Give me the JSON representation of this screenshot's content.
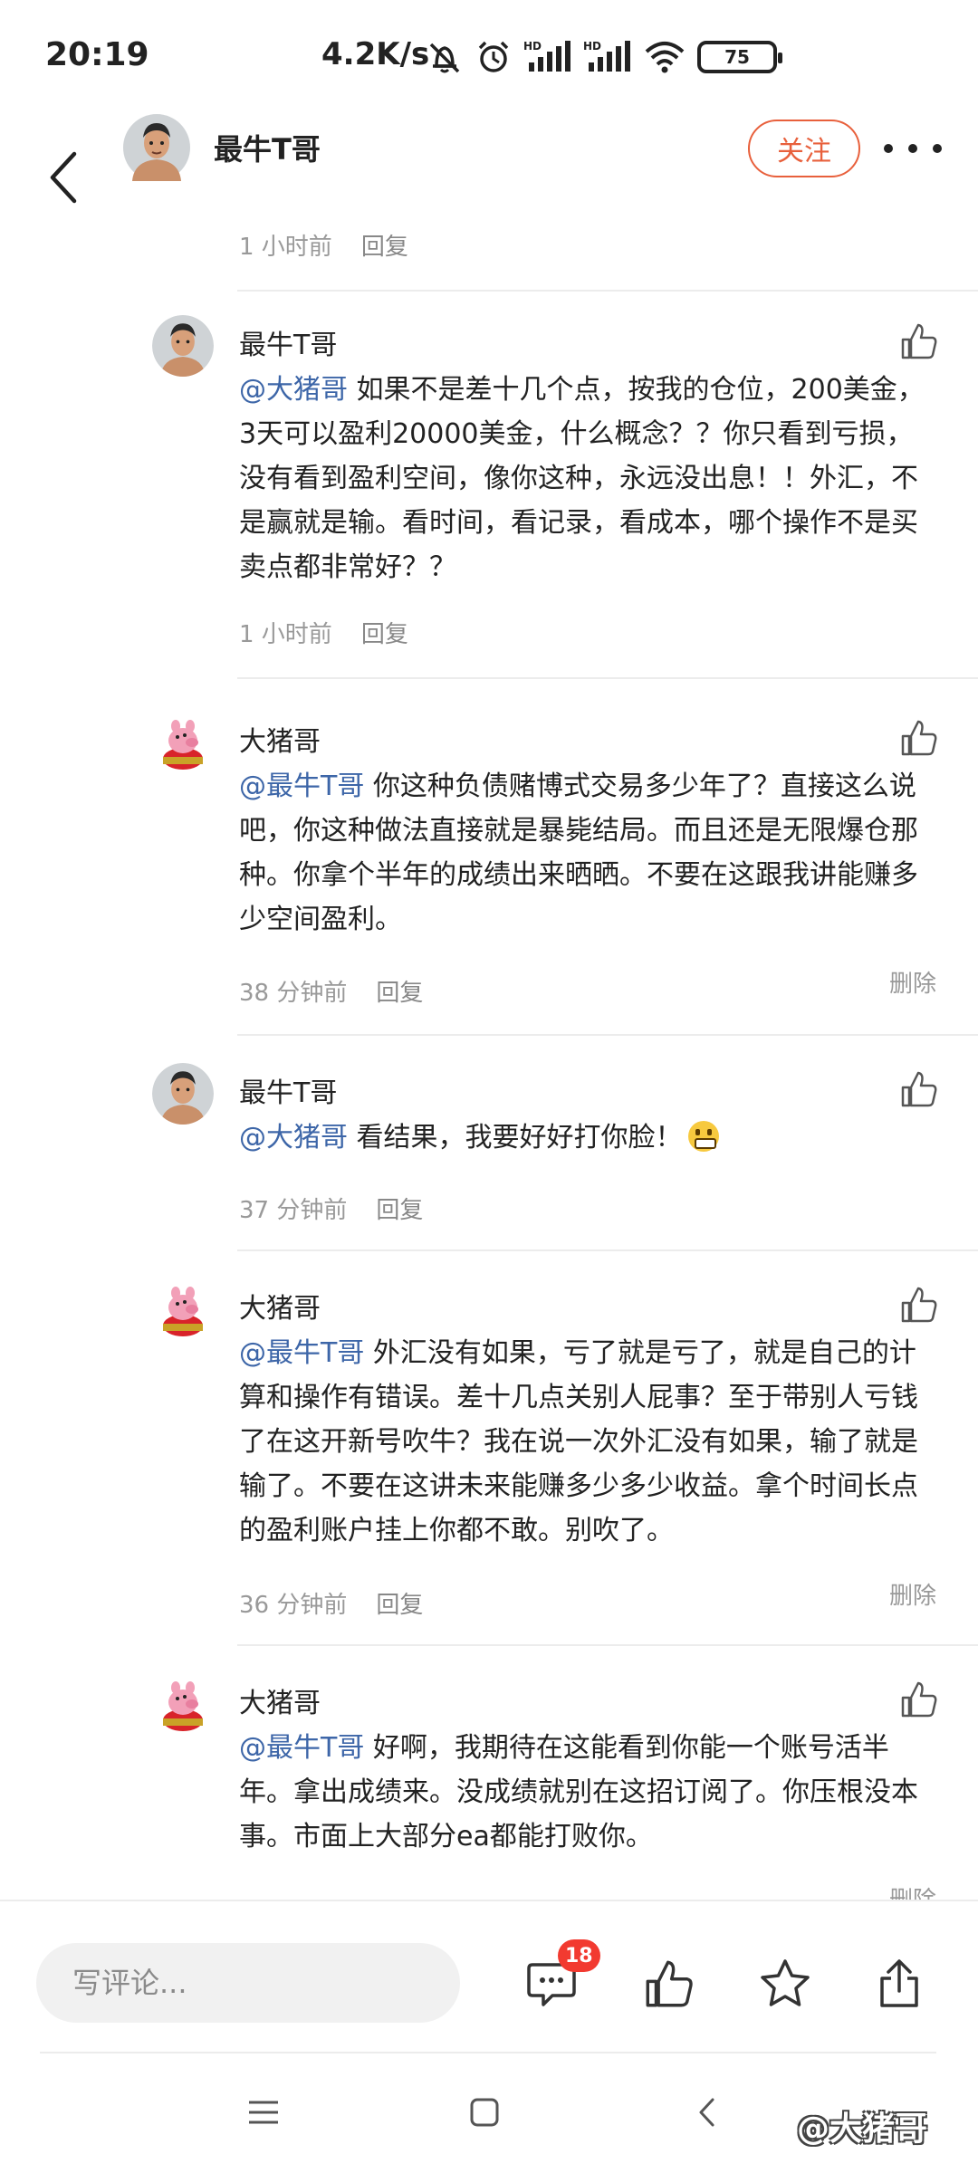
{
  "status_bar": {
    "time": "20:19",
    "network_speed": "4.2K/s",
    "battery": "75"
  },
  "header": {
    "author_name": "最牛T哥",
    "follow_label": "关注"
  },
  "top_meta": {
    "time": "1 小时前",
    "reply_label": "回复"
  },
  "comments": [
    {
      "name": "最牛T哥",
      "mention": "@大猪哥",
      "text": " 如果不是差十几个点，按我的仓位，200美金，3天可以盈利20000美金，什么概念？？你只看到亏损，没有看到盈利空间，像你这种，永远没出息！！外汇，不是赢就是输。看时间，看记录，看成本，哪个操作不是买卖点都非常好？？",
      "time": "1 小时前",
      "reply_label": "回复"
    },
    {
      "name": "大猪哥",
      "mention": "@最牛T哥",
      "text": " 你这种负债赌博式交易多少年了？直接这么说吧，你这种做法直接就是暴毙结局。而且还是无限爆仓那种。你拿个半年的成绩出来晒晒。不要在这跟我讲能赚多少空间盈利。",
      "time": "38 分钟前",
      "reply_label": "回复",
      "delete_label": "删除"
    },
    {
      "name": "最牛T哥",
      "mention": "@大猪哥",
      "text": " 看结果，我要好好打你脸！",
      "emoji": "grimacing-face",
      "time": "37 分钟前",
      "reply_label": "回复"
    },
    {
      "name": "大猪哥",
      "mention": "@最牛T哥",
      "text": " 外汇没有如果，亏了就是亏了，就是自己的计算和操作有错误。差十几点关别人屁事？至于带别人亏钱了在这开新号吹牛？我在说一次外汇没有如果，输了就是输了。不要在这讲未来能赚多少多少收益。拿个时间长点的盈利账户挂上你都不敢。别吹了。",
      "time": "36 分钟前",
      "reply_label": "回复",
      "delete_label": "删除"
    },
    {
      "name": "大猪哥",
      "mention": "@最牛T哥",
      "text": " 好啊，我期待在这能看到你能一个账号活半年。拿出成绩来。没成绩就别在这招订阅了。你压根没本事。市面上大部分ea都能打败你。",
      "delete_label": "删除"
    }
  ],
  "bottom_bar": {
    "comment_placeholder": "写评论...",
    "comment_count": "18"
  },
  "watermark": "@大猪哥",
  "colors": {
    "accent": "#e8603c",
    "mention": "#3d66a8",
    "badge": "#f23a30"
  }
}
